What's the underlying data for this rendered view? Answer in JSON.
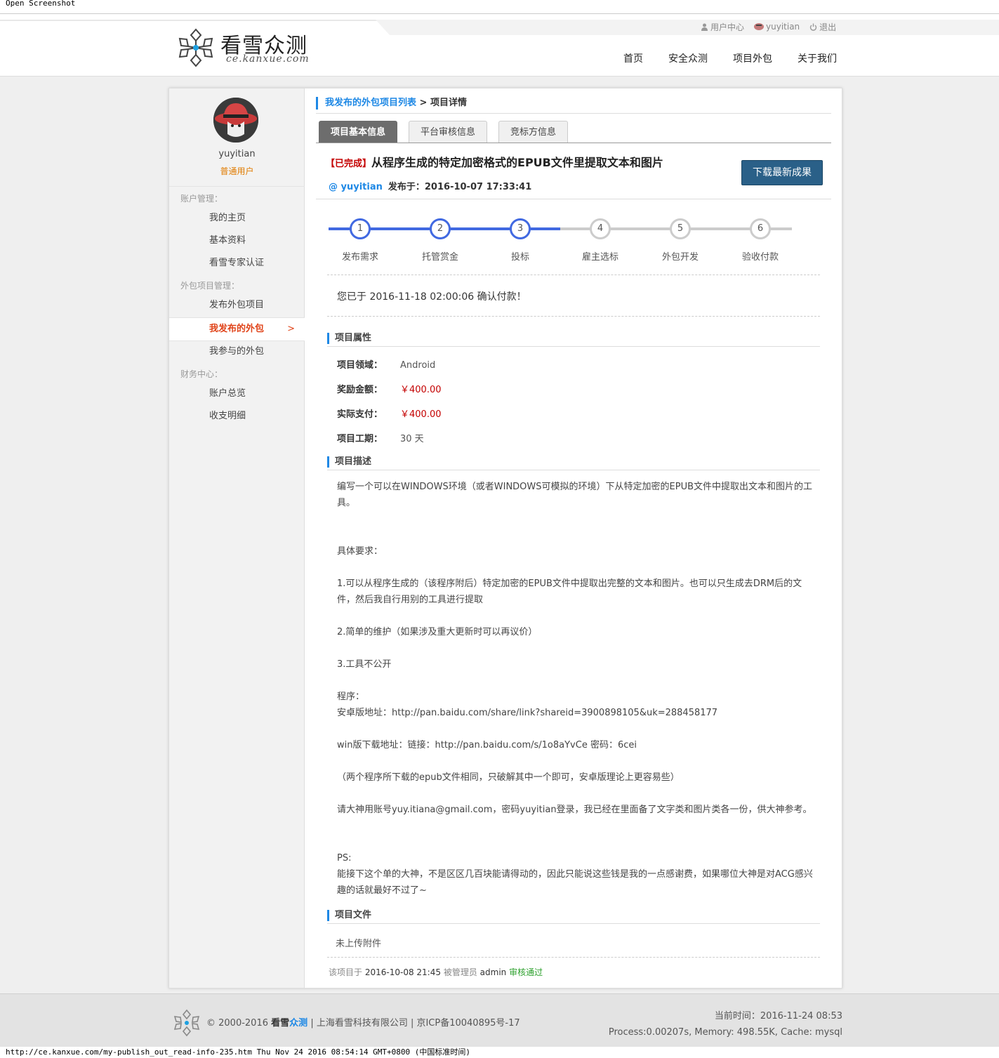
{
  "browser": {
    "top_label": "Open Screenshot",
    "status_url": "http://ce.kanxue.com/my-publish_out_read-info-235.htm Thu Nov 24 2016 08:54:14 GMT+0800 (中国标准时间)"
  },
  "header": {
    "logo_name": "看雪众测",
    "logo_domain": "ce.kanxue.com",
    "user_nav": {
      "user_center": "用户中心",
      "username": "yuyitian",
      "logout": "退出"
    },
    "main_nav": [
      "首页",
      "安全众测",
      "项目外包",
      "关于我们"
    ]
  },
  "sidebar": {
    "username": "yuyitian",
    "role": "普通用户",
    "cat_account": "账户管理：",
    "item_home": "我的主页",
    "item_profile": "基本资料",
    "item_expert": "看雪专家认证",
    "cat_outsource": "外包项目管理：",
    "item_publish": "发布外包项目",
    "item_my_published": "我发布的外包",
    "active_chevron": ">",
    "item_my_joined": "我参与的外包",
    "cat_finance": "财务中心：",
    "item_overview": "账户总览",
    "item_detail": "收支明细"
  },
  "breadcrumb": {
    "link": "我发布的外包项目列表",
    "sep": " > ",
    "current": "项目详情"
  },
  "tabs": [
    "项目基本信息",
    "平台审核信息",
    "竞标方信息"
  ],
  "project": {
    "status": "【已完成】",
    "title": "从程序生成的特定加密格式的EPUB文件里提取文本和图片",
    "download_button": "下载最新成果",
    "publisher": "@ yuyitian",
    "published_label": "发布于：2016-10-07 17:33:41"
  },
  "progress": {
    "current_step": 3,
    "steps": [
      {
        "num": "1",
        "label": "发布需求"
      },
      {
        "num": "2",
        "label": "托管赏金"
      },
      {
        "num": "3",
        "label": "投标"
      },
      {
        "num": "4",
        "label": "雇主选标"
      },
      {
        "num": "5",
        "label": "外包开发"
      },
      {
        "num": "6",
        "label": "验收付款"
      }
    ],
    "colors": {
      "done": "#4169e1",
      "todo": "#cccccc"
    }
  },
  "notice": "您已于 2016-11-18 02:00:06 确认付款！",
  "attributes": {
    "heading": "项目属性",
    "field_label": "项目领域：",
    "field_value": "Android",
    "reward_label": "奖励金额：",
    "reward_value": "￥400.00",
    "paid_label": "实际支付：",
    "paid_value": "￥400.00",
    "duration_label": "项目工期：",
    "duration_value": "30 天"
  },
  "description": {
    "heading": "项目描述",
    "paragraphs": [
      "编写一个可以在WINDOWS环境（或者WINDOWS可模拟的环境）下从特定加密的EPUB文件中提取出文本和图片的工具。",
      "具体要求：",
      "1.可以从程序生成的（该程序附后）特定加密的EPUB文件中提取出完整的文本和图片。也可以只生成去DRM后的文件，然后我自行用别的工具进行提取",
      "2.简单的维护（如果涉及重大更新时可以再议价）",
      "3.工具不公开",
      "程序：\n安卓版地址：http://pan.baidu.com/share/link?shareid=3900898105&uk=288458177",
      "win版下载地址：链接：http://pan.baidu.com/s/1o8aYvCe 密码：6cei",
      "（两个程序所下载的epub文件相同，只破解其中一个即可，安卓版理论上更容易些）",
      "请大神用账号yuy.itiana@gmail.com，密码yuyitian登录，我已经在里面备了文字类和图片类各一份，供大神参考。",
      "PS:\n能接下这个单的大神，不是区区几百块能请得动的，因此只能说这些钱是我的一点感谢费，如果哪位大神是对ACG感兴趣的话就最好不过了~"
    ]
  },
  "files": {
    "heading": "项目文件",
    "empty": "未上传附件"
  },
  "audit": {
    "prefix": "该项目于",
    "date": "2016-10-08 21:45",
    "by": "被管理员",
    "admin": "admin",
    "result": "审核通过"
  },
  "footer": {
    "copyright": "© 2000-2016",
    "brand_a": "看雪",
    "brand_b": "众测",
    "company": "| 上海看雪科技有限公司 | 京ICP备10040895号-17",
    "time": "当前时间：2016-11-24 08:53",
    "stats": "Process:0.00207s, Memory: 498.55K, Cache: mysql"
  }
}
